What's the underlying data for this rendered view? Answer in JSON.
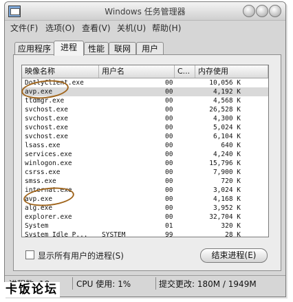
{
  "window": {
    "title": "Windows 任务管理器"
  },
  "menu": [
    "文件(F)",
    "选项(O)",
    "查看(V)",
    "关机(U)",
    "帮助(H)"
  ],
  "tabs": [
    "应用程序",
    "进程",
    "性能",
    "联网",
    "用户"
  ],
  "active_tab": "进程",
  "columns": [
    "映像名称",
    "用户名",
    "C...",
    "内存使用"
  ],
  "processes": [
    {
      "name": "DotlyClient.exe",
      "user": "",
      "cpu": "00",
      "mem": "10,056 K"
    },
    {
      "name": "avp.exe",
      "user": "",
      "cpu": "00",
      "mem": "4,192 K"
    },
    {
      "name": "ttdmgr.exe",
      "user": "",
      "cpu": "00",
      "mem": "4,568 K"
    },
    {
      "name": "svchost.exe",
      "user": "",
      "cpu": "00",
      "mem": "26,528 K"
    },
    {
      "name": "svchost.exe",
      "user": "",
      "cpu": "00",
      "mem": "4,300 K"
    },
    {
      "name": "svchost.exe",
      "user": "",
      "cpu": "00",
      "mem": "5,024 K"
    },
    {
      "name": "svchost.exe",
      "user": "",
      "cpu": "00",
      "mem": "6,104 K"
    },
    {
      "name": "lsass.exe",
      "user": "",
      "cpu": "00",
      "mem": "640 K"
    },
    {
      "name": "services.exe",
      "user": "",
      "cpu": "00",
      "mem": "4,240 K"
    },
    {
      "name": "winlogon.exe",
      "user": "",
      "cpu": "00",
      "mem": "15,796 K"
    },
    {
      "name": "csrss.exe",
      "user": "",
      "cpu": "00",
      "mem": "7,900 K"
    },
    {
      "name": "smss.exe",
      "user": "",
      "cpu": "00",
      "mem": "720 K"
    },
    {
      "name": "internat.exe",
      "user": "",
      "cpu": "00",
      "mem": "3,024 K"
    },
    {
      "name": "avp.exe",
      "user": "",
      "cpu": "00",
      "mem": "4,168 K"
    },
    {
      "name": "alg.exe",
      "user": "",
      "cpu": "00",
      "mem": "3,952 K"
    },
    {
      "name": "explorer.exe",
      "user": "",
      "cpu": "00",
      "mem": "32,704 K"
    },
    {
      "name": "System",
      "user": "",
      "cpu": "01",
      "mem": "320 K"
    },
    {
      "name": "System Idle P...",
      "user": "SYSTEM",
      "cpu": "99",
      "mem": "28 K"
    }
  ],
  "selected_row": 1,
  "checkbox": {
    "label": "显示所有用户的进程(S)",
    "checked": false
  },
  "end_button": "结束进程(E)",
  "status": {
    "processes": "进程数: 18",
    "cpu": "CPU 使用: 1%",
    "commit": "提交更改: 180M / 1949M"
  },
  "watermark": "卡饭论坛",
  "colors": {
    "annotation_circle": "#a0651c",
    "selection": "#d9d9d9"
  }
}
